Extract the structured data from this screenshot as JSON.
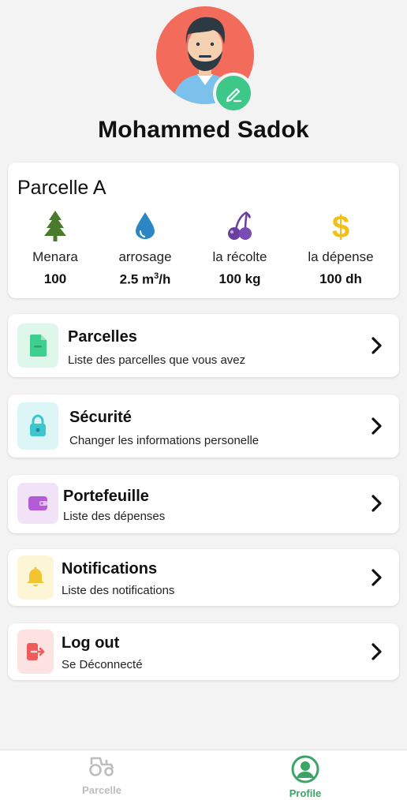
{
  "profile": {
    "name": "Mohammed Sadok",
    "avatar_bg": "#f26b5b",
    "edit_color": "#3dc889"
  },
  "parcel": {
    "title": "Parcelle A",
    "stats": [
      {
        "icon": "tree-icon",
        "label": "Menara",
        "value": "100"
      },
      {
        "icon": "water-drop-icon",
        "label": "arrosage",
        "value": "2.5 m",
        "value_sup": "3",
        "value_suffix": "/h"
      },
      {
        "icon": "cherry-icon",
        "label": "la récolte",
        "value": "100 kg"
      },
      {
        "icon": "dollar-icon",
        "label": "la dépense",
        "value": "100 dh"
      }
    ]
  },
  "menu": [
    {
      "icon": "document-icon",
      "title": "Parcelles",
      "subtitle": "Liste des parcelles que vous avez",
      "color": "#3ecf8e",
      "bg": "#dff6ea"
    },
    {
      "icon": "lock-icon",
      "title": "Sécurité",
      "subtitle": "Changer les informations personelle",
      "color": "#3ec6cf",
      "bg": "#dcf6f7"
    },
    {
      "icon": "wallet-icon",
      "title": "Portefeuille",
      "subtitle": "Liste des dépenses",
      "color": "#b45bd8",
      "bg": "#f1e2f8"
    },
    {
      "icon": "bell-icon",
      "title": "Notifications",
      "subtitle": "Liste des notifications",
      "color": "#f3c431",
      "bg": "#fdf6d6"
    },
    {
      "icon": "logout-icon",
      "title": "Log out",
      "subtitle": "Se Déconnecté",
      "color": "#ef5b5b",
      "bg": "#fde2e2"
    }
  ],
  "nav": {
    "items": [
      {
        "icon": "tractor-icon",
        "label": "Parcelle",
        "active": false
      },
      {
        "icon": "profile-icon",
        "label": "Profile",
        "active": true
      }
    ],
    "active_color": "#3aa564",
    "inactive_color": "#bdbdbd"
  }
}
